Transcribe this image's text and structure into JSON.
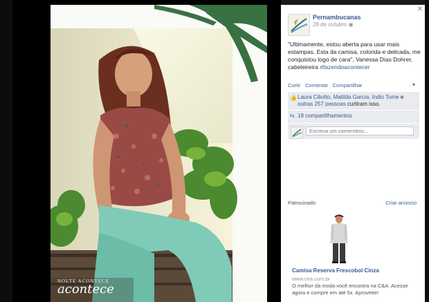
{
  "photo": {
    "caption_small": "NOLTE ACONTECE",
    "caption_big": "acontece"
  },
  "post": {
    "page_name": "Pernambucanas",
    "timestamp": "28 de outubro",
    "privacy_icon": "globe-icon",
    "text_body": "\"Ultimamente, estou aberta para usar mais estampas. Esta da camisa, colorida e delicada, me conquistou logo de cara\", Vanessa Dias Dohrer, cabeleireira ",
    "hashtag": "#fazendoacontecer",
    "actions": [
      "Curtir",
      "Comentar",
      "Compartilhar"
    ],
    "action_separator": " · "
  },
  "ufi": {
    "likes_names": "Laura Ciliotto, Matilda Garcia, Indio Tome",
    "likes_connector": " e ",
    "likes_others": "outras 257 pessoas",
    "likes_suffix": " curtiram isso.",
    "shares": "18 compartilhamentos",
    "comment_placeholder": "Escreva um comentário..."
  },
  "ad": {
    "sponsored_label": "Patrocinado",
    "create_ad": "Criar anúncio",
    "title": "Camisa Reserva Frescobol Cinza",
    "url": "www.cea.com.br",
    "description": "O melhor da moda você encontra na C&A. Acesse agora e compre em até 5x. Aproveite!"
  },
  "icons": {
    "close": "close-icon",
    "like": "thumbs-up-icon",
    "share": "share-icon",
    "settings": "settings-caret-icon"
  },
  "colors": {
    "link": "#3b5998",
    "ufi_bg": "#e9ebee",
    "stage_bg": "#000000"
  }
}
